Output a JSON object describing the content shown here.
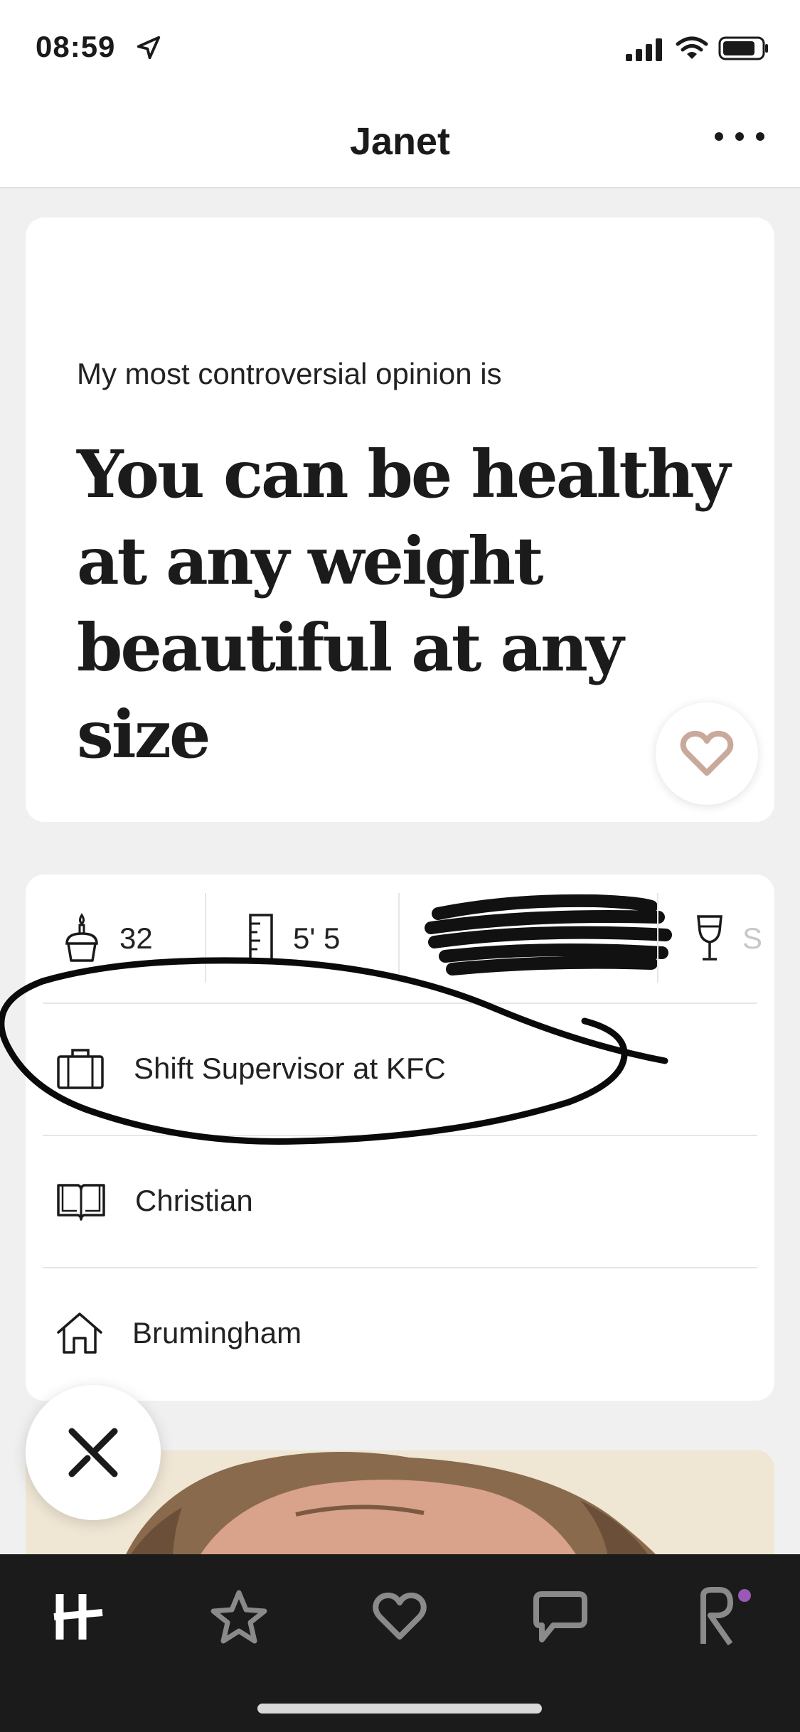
{
  "status_bar": {
    "time": "08:59"
  },
  "header": {
    "title": "Janet"
  },
  "prompt": {
    "question": "My most controversial opinion is",
    "answer": "You can be healthy at any weight beautiful at any size"
  },
  "vitals": {
    "age": "32",
    "height": "5' 5",
    "drinking": "S"
  },
  "details": {
    "job": "Shift Supervisor at KFC",
    "religion": "Christian",
    "hometown": "Brumingham"
  },
  "tabs": [
    "home",
    "standouts",
    "likes-you",
    "messages",
    "profile"
  ],
  "colors": {
    "like_heart": "#c9a99b",
    "tab_bar": "#1b1b1b",
    "tab_icon": "#8a8a8a",
    "notification_dot": "#9b59b6"
  }
}
